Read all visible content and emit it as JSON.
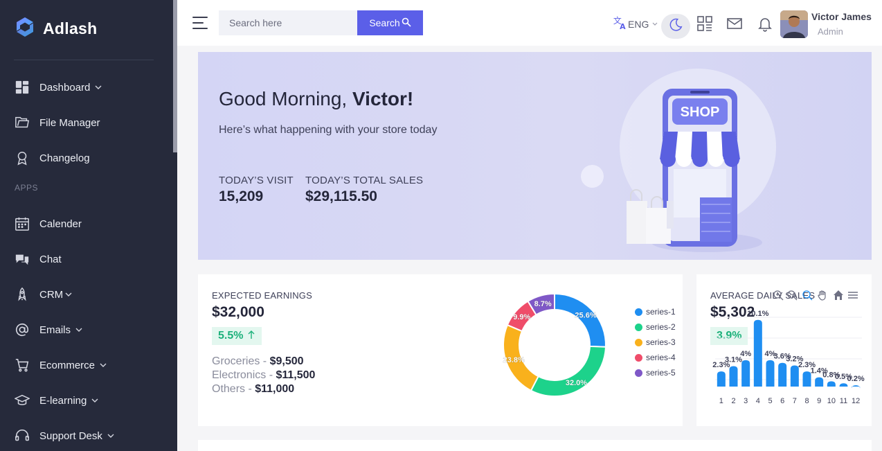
{
  "app": {
    "name": "Adlash"
  },
  "sidebar": {
    "section_label": "APPS",
    "items": [
      {
        "label": "Dashboard",
        "icon": "dashboard-icon",
        "has_submenu": true
      },
      {
        "label": "File Manager",
        "icon": "folder-icon",
        "has_submenu": false
      },
      {
        "label": "Changelog",
        "icon": "badge-icon",
        "has_submenu": false
      },
      {
        "label": "Calender",
        "icon": "calendar-icon",
        "has_submenu": false
      },
      {
        "label": "Chat",
        "icon": "chat-icon",
        "has_submenu": false
      },
      {
        "label": "CRM",
        "icon": "rocket-icon",
        "has_submenu": true
      },
      {
        "label": "Emails",
        "icon": "at-icon",
        "has_submenu": true
      },
      {
        "label": "Ecommerce",
        "icon": "cart-icon",
        "has_submenu": true
      },
      {
        "label": "E-learning",
        "icon": "graduation-cap-icon",
        "has_submenu": true
      },
      {
        "label": "Support Desk",
        "icon": "headset-icon",
        "has_submenu": true
      }
    ]
  },
  "header": {
    "search_placeholder": "Search here",
    "search_button": "Search",
    "language": "ENG",
    "user": {
      "name": "Victor James",
      "role": "Admin"
    }
  },
  "hero": {
    "greeting_prefix": "Good Morning,",
    "greeting_name": "Victor!",
    "subtitle": "Here’s what happening with your store today",
    "visit_label": "TODAY’S VISIT",
    "visit_value": "15,209",
    "sales_label": "TODAY’S TOTAL SALES",
    "sales_value": "$29,115.50",
    "shop_sign": "SHOP"
  },
  "earnings": {
    "title": "EXPECTED EARNINGS",
    "value": "$32,000",
    "change": "5.5%",
    "breakdown": [
      {
        "label": "Groceries",
        "value": "$9,500"
      },
      {
        "label": "Electronics",
        "value": "$11,500"
      },
      {
        "label": "Others",
        "value": "$11,000"
      }
    ]
  },
  "daily_sales": {
    "title": "AVERAGE DAILY SALES",
    "value": "$5,302",
    "change": "3.9%"
  },
  "colors": {
    "primary": "#5b5fe8",
    "sidebar_bg": "#262a3b",
    "positive": "#1db17b",
    "series": [
      "#1f8ef1",
      "#1dd28b",
      "#f9b11c",
      "#ef4d6a",
      "#7f58c7"
    ]
  },
  "chart_data": [
    {
      "type": "pie",
      "variant": "donut",
      "labels": [
        "series-1",
        "series-2",
        "series-3",
        "series-4",
        "series-5"
      ],
      "values": [
        25.6,
        32.0,
        23.8,
        9.9,
        8.7
      ],
      "value_labels": [
        "25.6%",
        "32.0%",
        "23.8%",
        "9.9%",
        "8.7%"
      ],
      "legend": "right"
    },
    {
      "type": "bar",
      "categories": [
        "1",
        "2",
        "3",
        "4",
        "5",
        "6",
        "7",
        "8",
        "9",
        "10",
        "11",
        "12"
      ],
      "values": [
        2.3,
        3.1,
        4,
        10.1,
        4,
        3.6,
        3.2,
        2.3,
        1.4,
        0.8,
        0.5,
        0.2
      ],
      "value_labels": [
        "2.3%",
        "3.1%",
        "4%",
        "10.1%",
        "4%",
        "3.6%",
        "3.2%",
        "2.3%",
        "1.4%",
        "0.8%",
        "0.5%",
        "0.2%"
      ],
      "grid": true,
      "toolbar": [
        "zoom-in-icon",
        "zoom-out-icon",
        "selection-zoom-icon",
        "pan-hand-icon",
        "home-icon",
        "menu-icon"
      ]
    }
  ]
}
